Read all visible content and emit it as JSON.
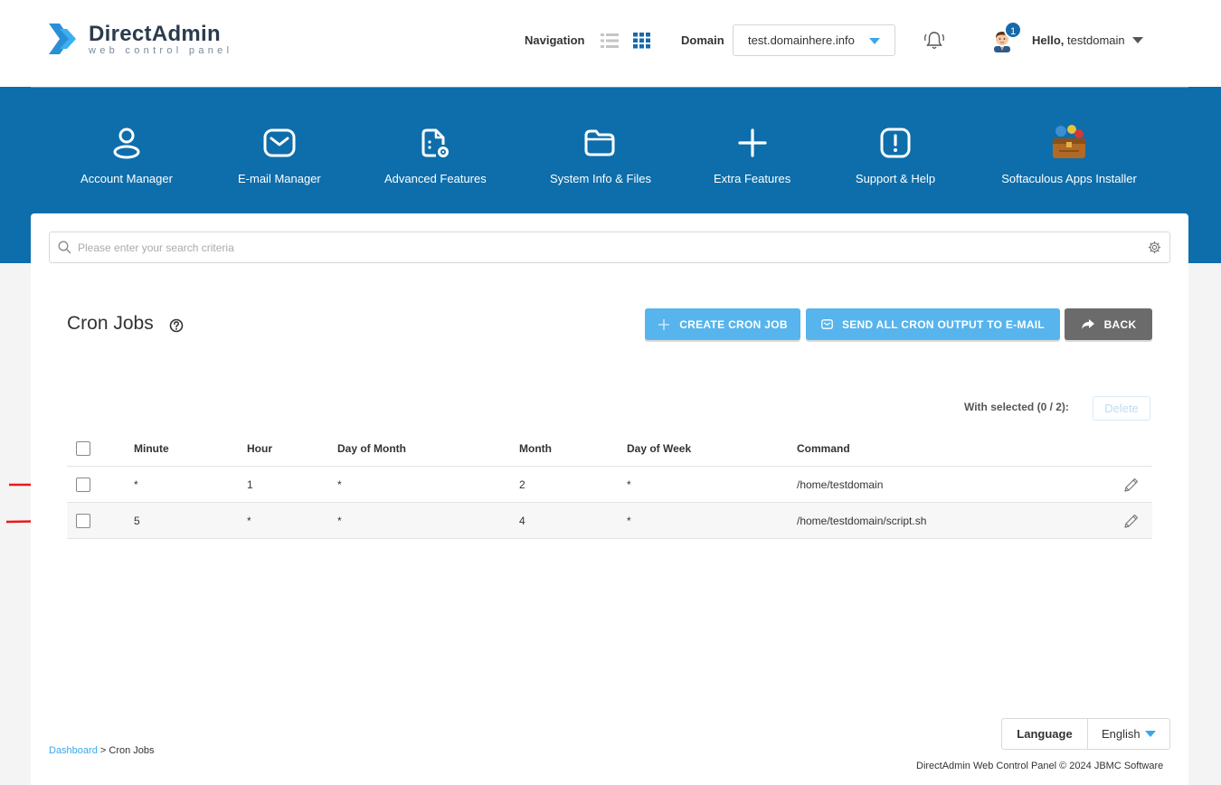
{
  "header": {
    "logo_title": "DirectAdmin",
    "logo_subtitle": "web control panel",
    "navigation_label": "Navigation",
    "domain_label": "Domain",
    "domain_value": "test.domainhere.info",
    "notification_count": "1",
    "hello_prefix": "Hello,",
    "username": "testdomain"
  },
  "menu": [
    {
      "label": "Account Manager",
      "icon": "user-icon"
    },
    {
      "label": "E-mail Manager",
      "icon": "mail-icon"
    },
    {
      "label": "Advanced Features",
      "icon": "file-gear-icon"
    },
    {
      "label": "System Info & Files",
      "icon": "folder-icon"
    },
    {
      "label": "Extra Features",
      "icon": "plus-icon"
    },
    {
      "label": "Support & Help",
      "icon": "exclamation-icon"
    },
    {
      "label": "Softaculous Apps Installer",
      "icon": "softaculous-icon"
    }
  ],
  "search": {
    "placeholder": "Please enter your search criteria"
  },
  "page": {
    "title": "Cron Jobs",
    "create_button": "CREATE CRON JOB",
    "send_button": "SEND ALL CRON OUTPUT TO E-MAIL",
    "back_button": "BACK",
    "with_selected": "With selected (0 / 2):",
    "delete_button": "Delete"
  },
  "table": {
    "columns": [
      "Minute",
      "Hour",
      "Day of Month",
      "Month",
      "Day of Week",
      "Command"
    ],
    "rows": [
      {
        "minute": "*",
        "hour": "1",
        "day_of_month": "*",
        "month": "2",
        "day_of_week": "*",
        "command": "/home/testdomain"
      },
      {
        "minute": "5",
        "hour": "*",
        "day_of_month": "*",
        "month": "4",
        "day_of_week": "*",
        "command": "/home/testdomain/script.sh"
      }
    ]
  },
  "footer": {
    "breadcrumb_link": "Dashboard",
    "breadcrumb_sep": " > ",
    "breadcrumb_current": "Cron Jobs",
    "language_label": "Language",
    "language_value": "English",
    "copyright": "DirectAdmin Web Control Panel © 2024 JBMC Software"
  },
  "colors": {
    "brand_blue": "#0d6eab",
    "accent": "#57b4ec",
    "annotation_arrow": "#e8191b"
  }
}
